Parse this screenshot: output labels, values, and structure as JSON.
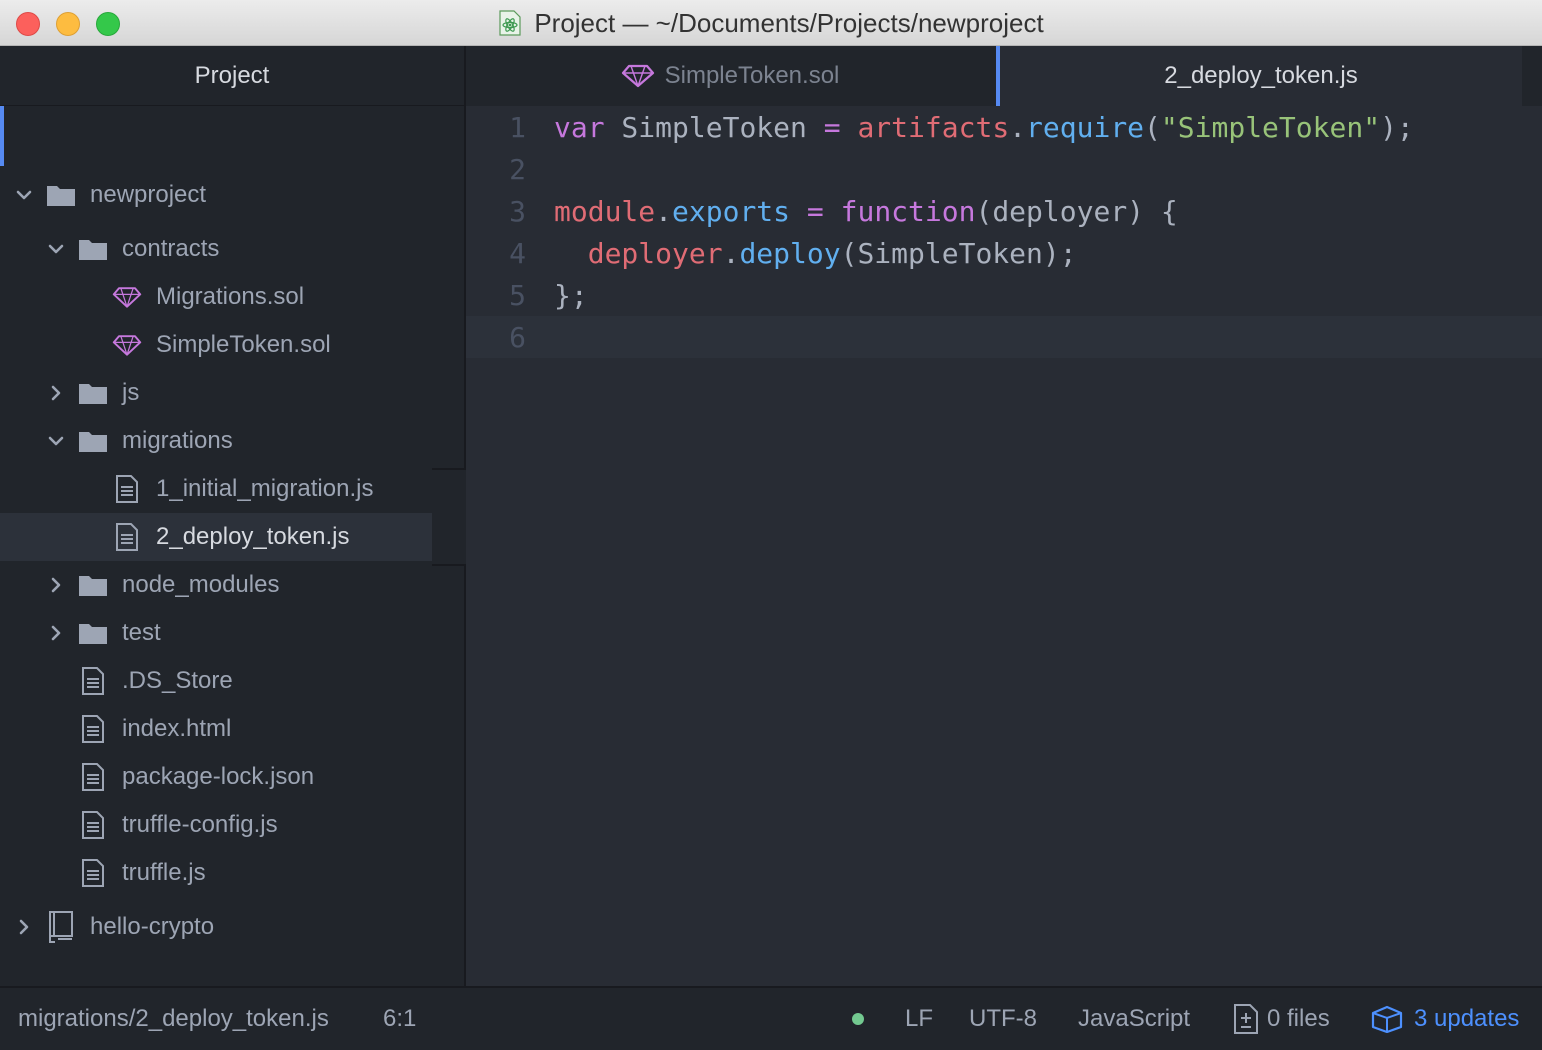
{
  "window": {
    "title": "Project — ~/Documents/Projects/newproject"
  },
  "sidebar": {
    "header": "Project",
    "items": [
      {
        "label": "newproject",
        "type": "folder",
        "expanded": true
      },
      {
        "label": "contracts",
        "type": "folder",
        "expanded": true
      },
      {
        "label": "Migrations.sol",
        "type": "solidity-file"
      },
      {
        "label": "SimpleToken.sol",
        "type": "solidity-file"
      },
      {
        "label": "js",
        "type": "folder",
        "expanded": false
      },
      {
        "label": "migrations",
        "type": "folder",
        "expanded": true
      },
      {
        "label": "1_initial_migration.js",
        "type": "file"
      },
      {
        "label": "2_deploy_token.js",
        "type": "file",
        "selected": true
      },
      {
        "label": "node_modules",
        "type": "folder",
        "expanded": false
      },
      {
        "label": "test",
        "type": "folder",
        "expanded": false
      },
      {
        "label": ".DS_Store",
        "type": "file"
      },
      {
        "label": "index.html",
        "type": "file"
      },
      {
        "label": "package-lock.json",
        "type": "file"
      },
      {
        "label": "truffle-config.js",
        "type": "file"
      },
      {
        "label": "truffle.js",
        "type": "file"
      },
      {
        "label": "hello-crypto",
        "type": "repo",
        "expanded": false
      }
    ]
  },
  "tabs": [
    {
      "label": "SimpleToken.sol",
      "active": false
    },
    {
      "label": "2_deploy_token.js",
      "active": true
    }
  ],
  "editor": {
    "line_numbers": [
      "1",
      "2",
      "3",
      "4",
      "5",
      "6"
    ],
    "lines": [
      [
        {
          "t": "kw",
          "v": "var"
        },
        {
          "t": "plain",
          "v": " SimpleToken "
        },
        {
          "t": "kw",
          "v": "="
        },
        {
          "t": "plain",
          "v": " "
        },
        {
          "t": "var",
          "v": "artifacts"
        },
        {
          "t": "plain",
          "v": "."
        },
        {
          "t": "fn",
          "v": "require"
        },
        {
          "t": "plain",
          "v": "("
        },
        {
          "t": "str",
          "v": "\"SimpleToken\""
        },
        {
          "t": "plain",
          "v": ");"
        }
      ],
      [],
      [
        {
          "t": "var",
          "v": "module"
        },
        {
          "t": "plain",
          "v": "."
        },
        {
          "t": "fn",
          "v": "exports"
        },
        {
          "t": "plain",
          "v": " "
        },
        {
          "t": "kw",
          "v": "="
        },
        {
          "t": "plain",
          "v": " "
        },
        {
          "t": "kw",
          "v": "function"
        },
        {
          "t": "plain",
          "v": "(deployer) {"
        }
      ],
      [
        {
          "t": "plain",
          "v": "  "
        },
        {
          "t": "var",
          "v": "deployer"
        },
        {
          "t": "plain",
          "v": "."
        },
        {
          "t": "fn",
          "v": "deploy"
        },
        {
          "t": "plain",
          "v": "(SimpleToken);"
        }
      ],
      [
        {
          "t": "plain",
          "v": "};"
        }
      ],
      []
    ]
  },
  "status": {
    "path": "migrations/2_deploy_token.js",
    "cursor": "6:1",
    "line_ending": "LF",
    "encoding": "UTF-8",
    "grammar": "JavaScript",
    "files": "0 files",
    "updates": "3 updates"
  },
  "colors": {
    "accent": "#568af2",
    "solidity_icon": "#c678dd",
    "git_clean": "#73c990",
    "updates": "#4d90fe"
  }
}
